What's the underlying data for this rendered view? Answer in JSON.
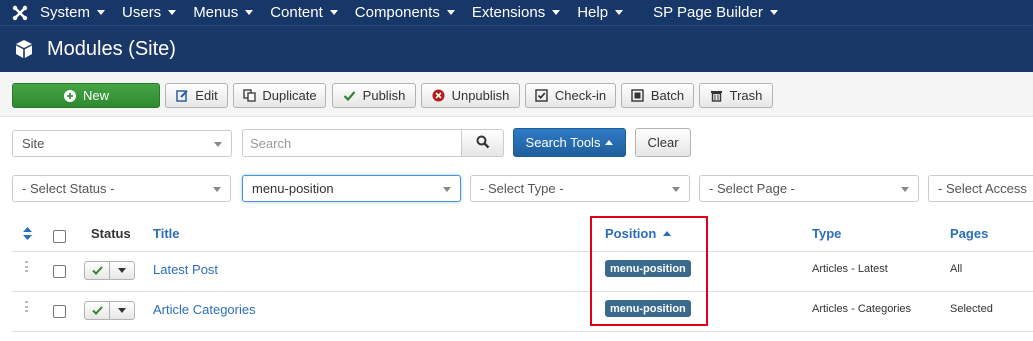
{
  "topnav": {
    "items": [
      {
        "label": "System"
      },
      {
        "label": "Users"
      },
      {
        "label": "Menus"
      },
      {
        "label": "Content"
      },
      {
        "label": "Components"
      },
      {
        "label": "Extensions"
      },
      {
        "label": "Help"
      },
      {
        "label": "SP Page Builder"
      }
    ]
  },
  "header": {
    "title": "Modules (Site)"
  },
  "toolbar": {
    "new": "New",
    "edit": "Edit",
    "duplicate": "Duplicate",
    "publish": "Publish",
    "unpublish": "Unpublish",
    "checkin": "Check-in",
    "batch": "Batch",
    "trash": "Trash"
  },
  "filters": {
    "client": "Site",
    "search_placeholder": "Search",
    "search_tools": "Search Tools",
    "clear": "Clear",
    "status": "- Select Status -",
    "position": "menu-position",
    "type": "- Select Type -",
    "page": "- Select Page -",
    "access": "- Select Access"
  },
  "table": {
    "headers": {
      "status": "Status",
      "title": "Title",
      "position": "Position",
      "type": "Type",
      "pages": "Pages"
    },
    "rows": [
      {
        "title": "Latest Post",
        "position": "menu-position",
        "type": "Articles - Latest",
        "pages": "All"
      },
      {
        "title": "Article Categories",
        "position": "menu-position",
        "type": "Articles - Categories",
        "pages": "Selected"
      }
    ]
  },
  "colors": {
    "nav_bg": "#173769",
    "title_bg": "#1a3867",
    "new_button": "#46a546",
    "link": "#2a6ebb",
    "badge": "#3a6a8e",
    "highlight": "#e0001b"
  }
}
